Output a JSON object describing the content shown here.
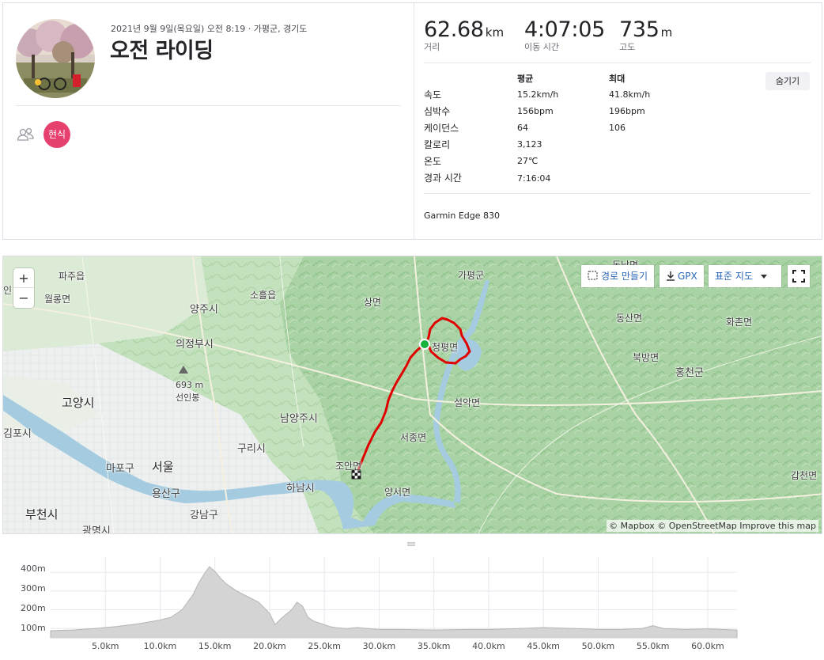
{
  "activity": {
    "datetime_location": "2021년 9월 9일(목요일) 오전 8:19 · 가평군, 경기도",
    "title": "오전 라이딩",
    "mention_badge": "현식",
    "people_icon": "people-icon"
  },
  "stats": {
    "distance": {
      "value": "62.68",
      "unit": "km",
      "label": "거리"
    },
    "moving_time": {
      "value": "4:07:05",
      "label": "이동 시간"
    },
    "elevation": {
      "value": "735",
      "unit": "m",
      "label": "고도"
    }
  },
  "details": {
    "hide_label": "숨기기",
    "headers": {
      "avg": "평균",
      "max": "최대"
    },
    "rows": [
      {
        "name": "속도",
        "avg": "15.2km/h",
        "max": "41.8km/h"
      },
      {
        "name": "심박수",
        "avg": "156bpm",
        "max": "196bpm"
      },
      {
        "name": "케이던스",
        "avg": "64",
        "max": "106"
      },
      {
        "name": "칼로리",
        "avg": "3,123",
        "max": ""
      },
      {
        "name": "온도",
        "avg": "27℃",
        "max": ""
      },
      {
        "name": "경과 시간",
        "avg": "7:16:04",
        "max": ""
      }
    ],
    "device": "Garmin Edge 830"
  },
  "map": {
    "controls": {
      "zoom_in": "+",
      "zoom_out": "−",
      "create_route": "경로 만들기",
      "gpx": "GPX",
      "map_type": "표준 지도"
    },
    "attribution": "© Mapbox © OpenStreetMap Improve this map",
    "places": {
      "p1": "파주읍",
      "p2": "월롱면",
      "p3": "양주시",
      "p4": "소흘읍",
      "p5": "가평군",
      "p6": "상면",
      "p7": "의정부시",
      "p8": "693 m",
      "p9": "선인봉",
      "p10": "고양시",
      "p11": "남양주시",
      "p12": "설악면",
      "p13": "동산면",
      "p14": "화촌면",
      "p15": "북방면",
      "p16": "홍천군",
      "p17": "김포시",
      "p18": "구리시",
      "p19": "서종면",
      "p20": "마포구",
      "p21": "서울",
      "p22": "조안면",
      "p23": "하남시",
      "p24": "양서면",
      "p25": "용산구",
      "p26": "부천시",
      "p27": "강남구",
      "p28": "광명시",
      "p29": "갑천면",
      "p30": "청평면",
      "p31": "동남면",
      "p32": "인"
    }
  },
  "chart_data": {
    "type": "area",
    "title": "",
    "xlabel": "",
    "ylabel": "",
    "x_ticks": [
      "5.0km",
      "10.0km",
      "15.0km",
      "20.0km",
      "25.0km",
      "30.0km",
      "35.0km",
      "40.0km",
      "45.0km",
      "50.0km",
      "55.0km",
      "60.0km"
    ],
    "y_ticks": [
      "400m",
      "300m",
      "200m",
      "100m"
    ],
    "xlim": [
      0,
      62.68
    ],
    "ylim": [
      50,
      460
    ],
    "x": [
      0,
      2,
      4,
      6,
      8,
      9,
      10,
      11,
      12,
      13,
      13.5,
      14,
      14.5,
      15,
      15.5,
      16,
      17,
      18,
      19,
      20,
      20.5,
      21,
      22,
      22.5,
      23,
      23.5,
      24,
      25,
      25.5,
      26,
      27,
      28,
      29,
      30,
      32,
      35,
      38,
      40,
      42,
      45,
      48,
      50,
      52,
      54,
      55,
      56,
      58,
      60,
      62.68
    ],
    "values": [
      88,
      92,
      100,
      110,
      125,
      135,
      145,
      160,
      200,
      280,
      340,
      390,
      430,
      405,
      370,
      340,
      300,
      270,
      240,
      180,
      120,
      150,
      200,
      240,
      220,
      160,
      140,
      120,
      110,
      105,
      100,
      105,
      100,
      95,
      95,
      92,
      95,
      95,
      98,
      105,
      100,
      95,
      95,
      100,
      115,
      100,
      95,
      98,
      92
    ],
    "grid": true
  },
  "colors": {
    "accent": "#fc5200",
    "route": "#e00000",
    "mention": "#e6406f",
    "elevation_fill": "#d4d4d4"
  }
}
